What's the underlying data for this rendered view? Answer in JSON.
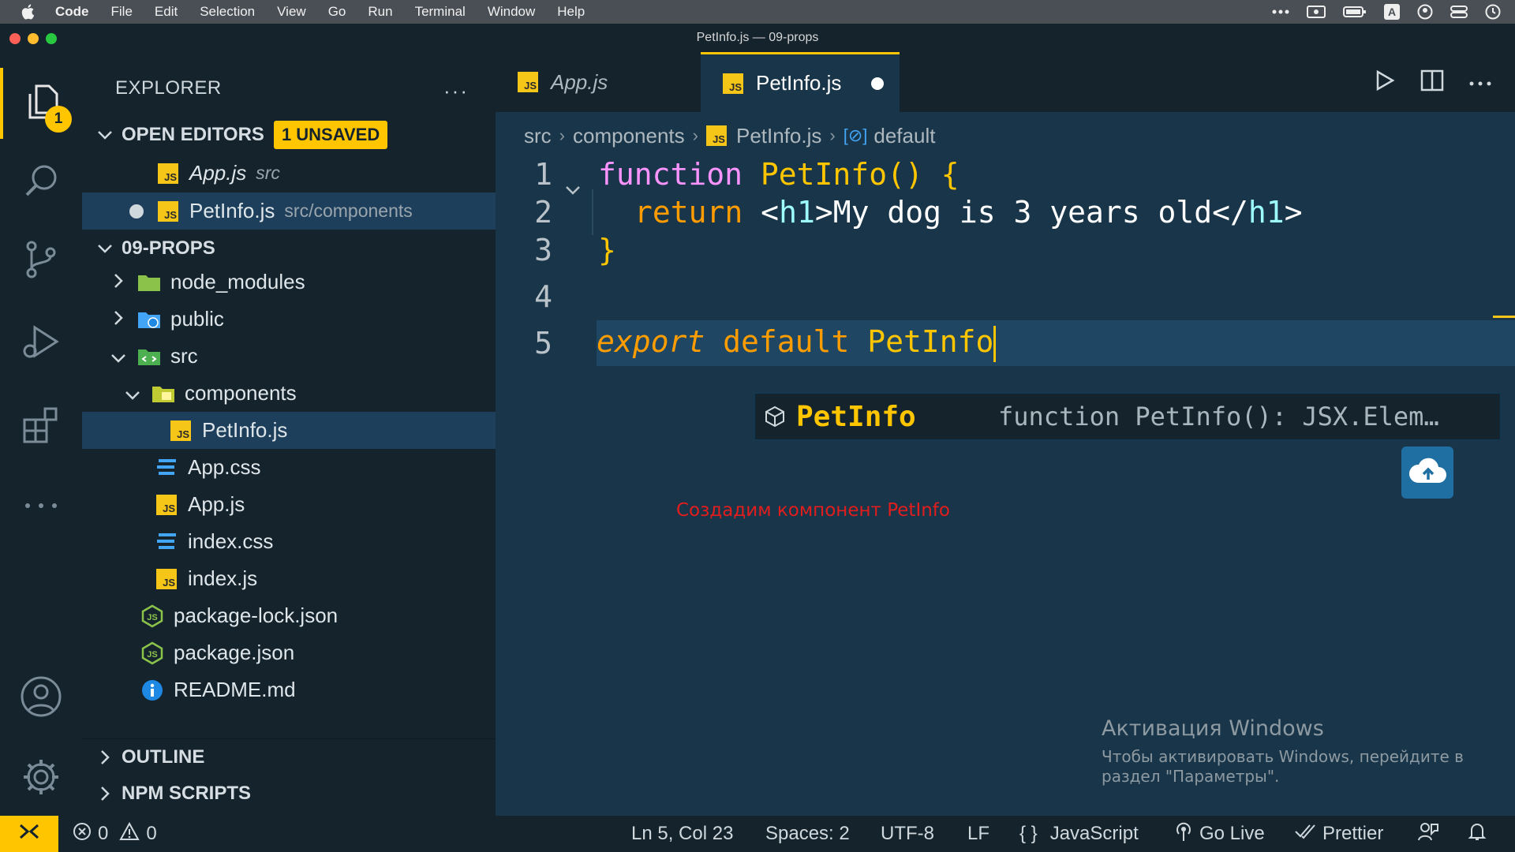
{
  "menubar": {
    "app": "Code",
    "items": [
      "File",
      "Edit",
      "Selection",
      "View",
      "Go",
      "Run",
      "Terminal",
      "Window",
      "Help"
    ]
  },
  "window": {
    "title": "PetInfo.js — 09-props"
  },
  "activity": {
    "explorer_badge": "1"
  },
  "sidebar": {
    "header": "EXPLORER",
    "open_editors": {
      "title": "OPEN EDITORS",
      "badge": "1 UNSAVED",
      "items": [
        {
          "name": "App.js",
          "path": "src"
        },
        {
          "name": "PetInfo.js",
          "path": "src/components"
        }
      ]
    },
    "project": {
      "title": "09-PROPS",
      "items": [
        "node_modules",
        "public",
        "src",
        "components",
        "PetInfo.js",
        "App.css",
        "App.js",
        "index.css",
        "index.js",
        "package-lock.json",
        "package.json",
        "README.md"
      ]
    },
    "outline": "OUTLINE",
    "npm_scripts": "NPM SCRIPTS"
  },
  "tabs": [
    {
      "label": "App.js",
      "active": false
    },
    {
      "label": "PetInfo.js",
      "active": true,
      "unsaved": true
    }
  ],
  "breadcrumb": [
    "src",
    "components",
    "PetInfo.js",
    "default"
  ],
  "code": {
    "line_numbers": [
      "1",
      "2",
      "3",
      "4",
      "5"
    ],
    "l1": {
      "kw": "function",
      "name": "PetInfo",
      "paren": "()",
      "brace": "{"
    },
    "l2": {
      "kw": "return",
      "open_lt": "<",
      "tag": "h1",
      "open_gt": ">",
      "text": "My dog is 3 years old",
      "close_lt": "</",
      "close_tag": "h1",
      "close_gt": ">"
    },
    "l3": {
      "brace": "}"
    },
    "l5": {
      "export": "export",
      "default": "default",
      "name": "PetInfo"
    }
  },
  "suggestion": {
    "label": "PetInfo",
    "detail": "function PetInfo(): JSX.Elem…"
  },
  "caption": "Создадим компонент PetInfo",
  "activation": {
    "title": "Активация Windows",
    "text": "Чтобы активировать Windows, перейдите в раздел \"Параметры\"."
  },
  "statusbar": {
    "errors": "0",
    "warnings": "0",
    "position": "Ln 5, Col 23",
    "spaces": "Spaces: 2",
    "encoding": "UTF-8",
    "eol": "LF",
    "language": "JavaScript",
    "go_live": "Go Live",
    "prettier": "Prettier"
  },
  "colors": {
    "accent": "#ffc600",
    "editor_bg": "#193549",
    "sidebar_bg": "#15232d"
  }
}
